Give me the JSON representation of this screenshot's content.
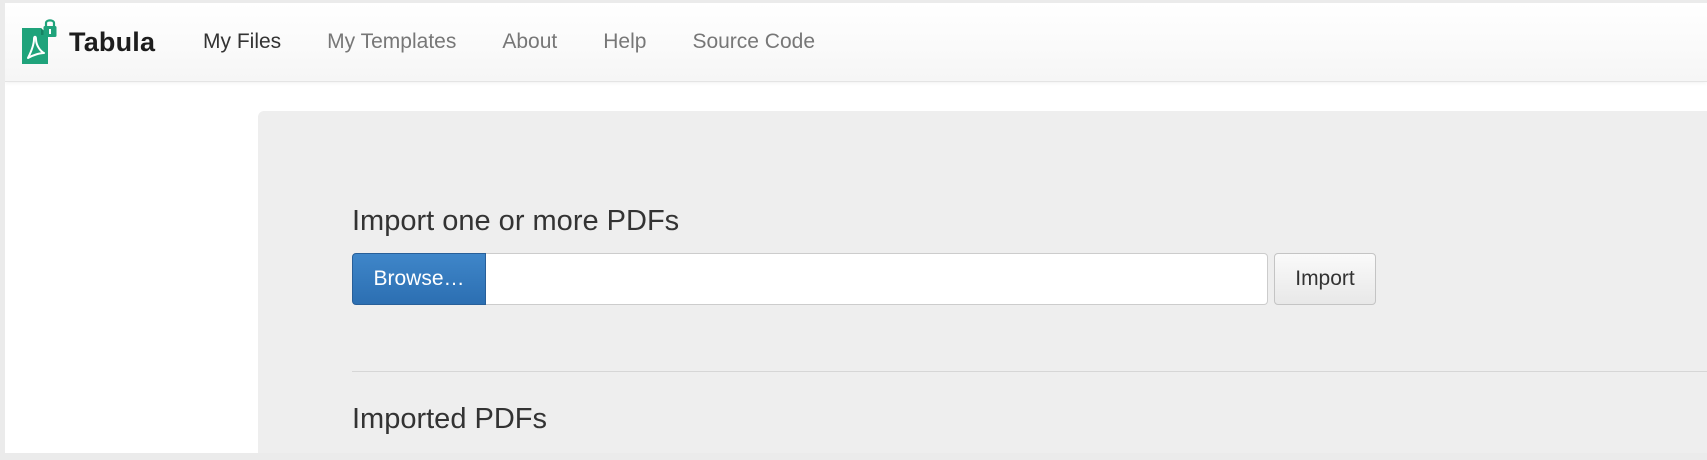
{
  "app": {
    "name": "Tabula",
    "logo_icon": "tabula-pdf-lock-icon",
    "brand_color": "#1fa37b"
  },
  "nav": {
    "items": [
      {
        "label": "My Files",
        "active": true
      },
      {
        "label": "My Templates",
        "active": false
      },
      {
        "label": "About",
        "active": false
      },
      {
        "label": "Help",
        "active": false
      },
      {
        "label": "Source Code",
        "active": false
      }
    ]
  },
  "import": {
    "title": "Import one or more PDFs",
    "browse_label": "Browse…",
    "file_value": "",
    "import_label": "Import",
    "browse_color": "#337ab7"
  },
  "imported": {
    "title": "Imported PDFs"
  }
}
